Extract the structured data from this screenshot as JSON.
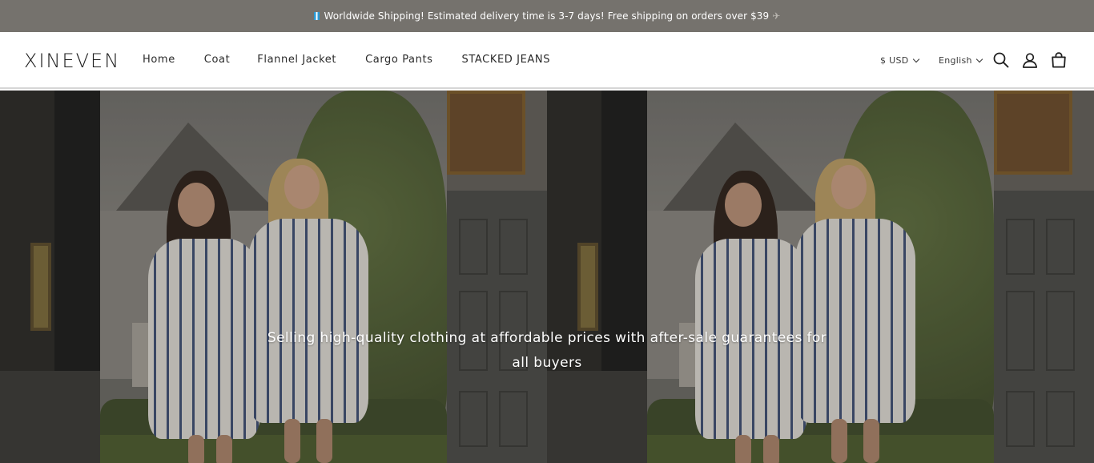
{
  "announcement": {
    "text": "Worldwide Shipping! Estimated delivery time is 3-7 days! Free shipping on orders over $39",
    "plane_glyph": "✈"
  },
  "header": {
    "logo": "XINEVEN",
    "nav": [
      "Home",
      "Coat",
      "Flannel Jacket",
      "Cargo Pants",
      "STACKED JEANS"
    ],
    "currency": "$ USD",
    "language": "English",
    "icons": [
      "search-icon",
      "account-icon",
      "cart-icon"
    ]
  },
  "hero": {
    "tagline_line1": "Selling high-quality clothing at affordable prices with after-sale guarantees for",
    "tagline_line2": "all buyers"
  },
  "colors": {
    "announcement_bg": "#75726d",
    "header_bg": "#ffffff",
    "text": "#1f1f1f"
  }
}
